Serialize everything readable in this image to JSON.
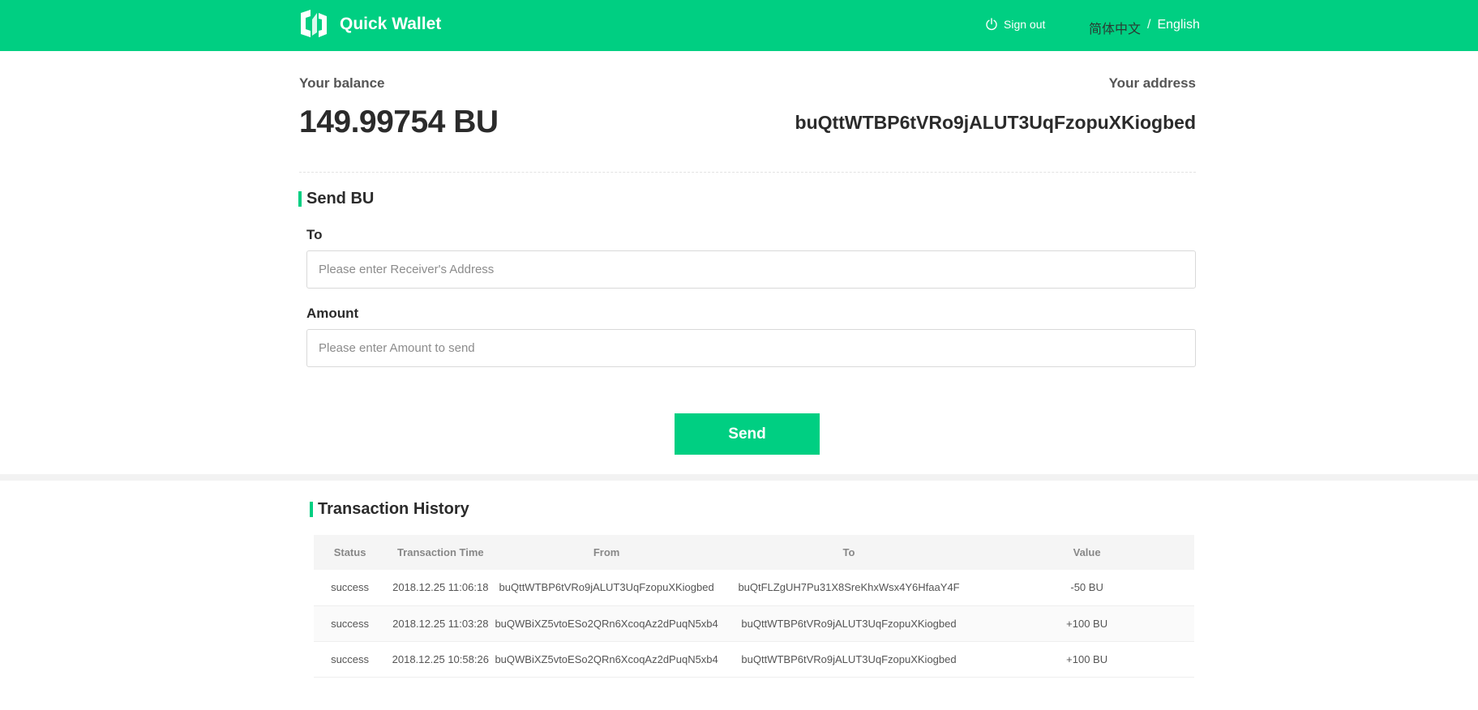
{
  "header": {
    "brand": "Quick Wallet",
    "logo_icon": "quick-wallet-logo",
    "sign_out": "Sign out",
    "sign_out_icon": "power-icon",
    "lang_zh": "简体中文",
    "lang_sep": "/",
    "lang_en": "English"
  },
  "account": {
    "balance_label": "Your balance",
    "balance_value": "149.99754 BU",
    "address_label": "Your address",
    "address_value": "buQttWTBP6tVRo9jALUT3UqFzopuXKiogbed"
  },
  "send": {
    "title": "Send BU",
    "to_label": "To",
    "to_placeholder": "Please enter Receiver's Address",
    "amount_label": "Amount",
    "amount_placeholder": "Please enter Amount to send",
    "button": "Send"
  },
  "history": {
    "title": "Transaction History",
    "columns": [
      "Status",
      "Transaction Time",
      "From",
      "To",
      "Value"
    ],
    "rows": [
      [
        "success",
        "2018.12.25 11:06:18",
        "buQttWTBP6tVRo9jALUT3UqFzopuXKiogbed",
        "buQtFLZgUH7Pu31X8SreKhxWsx4Y6HfaaY4F",
        "-50 BU"
      ],
      [
        "success",
        "2018.12.25 11:03:28",
        "buQWBiXZ5vtoESo2QRn6XcoqAz2dPuqN5xb4",
        "buQttWTBP6tVRo9jALUT3UqFzopuXKiogbed",
        "+100 BU"
      ],
      [
        "success",
        "2018.12.25 10:58:26",
        "buQWBiXZ5vtoESo2QRn6XcoqAz2dPuqN5xb4",
        "buQttWTBP6tVRo9jALUT3UqFzopuXKiogbed",
        "+100 BU"
      ]
    ]
  },
  "colors": {
    "accent": "#00cf82",
    "text_dark": "#2b2b2b",
    "muted": "#888888"
  }
}
